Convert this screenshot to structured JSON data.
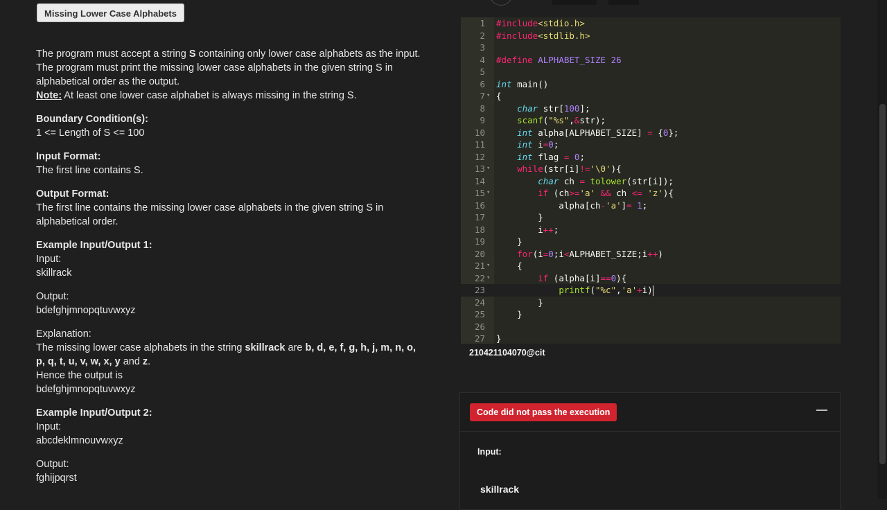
{
  "problem": {
    "title": "Missing Lower Case Alphabets",
    "desc_pre": "The program must accept a string ",
    "desc_var": "S",
    "desc_post": " containing only lower case alphabets as the input. The program must print the missing lower case alphabets in the given string S in alphabetical order as the output.",
    "note_label": "Note:",
    "note_text": " At least one lower case alphabet is always missing in the string S.",
    "boundary_heading": "Boundary Condition(s):",
    "boundary_text": "1 <= Length of S <= 100",
    "input_format_heading": "Input Format:",
    "input_format_text": "The first line contains S.",
    "output_format_heading": "Output Format:",
    "output_format_text": "The first line contains the missing lower case alphabets in the given string S in alphabetical order.",
    "example1_heading": "Example Input/Output 1:",
    "input_label": "Input:",
    "example1_input": "skillrack",
    "output_label": "Output:",
    "example1_output": "bdefghjmnopqtuvwxyz",
    "explanation_label": "Explanation:",
    "expl_pre": "The missing lower case alphabets in the string ",
    "expl_word": "skillrack",
    "expl_mid": " are ",
    "expl_letters": "b, d, e, f, g, h, j, m, n, o, p, q, t, u, v, w, x, y",
    "expl_and": " and ",
    "expl_last": "z",
    "expl_end": ".",
    "hence_text": "Hence the output is",
    "hence_output": "bdefghjmnopqtuvwxyz",
    "example2_heading": "Example Input/Output 2:",
    "example2_input": "abcdeklmnouvwxyz",
    "example2_output": "fghijpqrst"
  },
  "editor": {
    "active_line": 23,
    "lines": [
      {
        "n": 1,
        "fold": false,
        "tokens": [
          [
            "op",
            "#include"
          ],
          [
            "str",
            "<stdio.h>"
          ]
        ]
      },
      {
        "n": 2,
        "fold": false,
        "tokens": [
          [
            "op",
            "#include"
          ],
          [
            "str",
            "<stdlib.h>"
          ]
        ]
      },
      {
        "n": 3,
        "fold": false,
        "tokens": []
      },
      {
        "n": 4,
        "fold": false,
        "tokens": [
          [
            "op",
            "#define"
          ],
          [
            "t",
            " "
          ],
          [
            "con",
            "ALPHABET_SIZE"
          ],
          [
            "t",
            " "
          ],
          [
            "num",
            "26"
          ]
        ]
      },
      {
        "n": 5,
        "fold": false,
        "tokens": []
      },
      {
        "n": 6,
        "fold": false,
        "tokens": [
          [
            "kw",
            "int"
          ],
          [
            "t",
            " main()"
          ]
        ]
      },
      {
        "n": 7,
        "fold": true,
        "tokens": [
          [
            "t",
            "{"
          ]
        ]
      },
      {
        "n": 8,
        "fold": false,
        "tokens": [
          [
            "t",
            "    "
          ],
          [
            "kw",
            "char"
          ],
          [
            "t",
            " str["
          ],
          [
            "num",
            "100"
          ],
          [
            "t",
            "];"
          ]
        ]
      },
      {
        "n": 9,
        "fold": false,
        "tokens": [
          [
            "t",
            "    "
          ],
          [
            "fn",
            "scanf"
          ],
          [
            "t",
            "("
          ],
          [
            "str",
            "\"%s\""
          ],
          [
            "t",
            ","
          ],
          [
            "op",
            "&"
          ],
          [
            "t",
            "str);"
          ]
        ]
      },
      {
        "n": 10,
        "fold": false,
        "tokens": [
          [
            "t",
            "    "
          ],
          [
            "kw",
            "int"
          ],
          [
            "t",
            " alpha[ALPHABET_SIZE] "
          ],
          [
            "op",
            "="
          ],
          [
            "t",
            " {"
          ],
          [
            "num",
            "0"
          ],
          [
            "t",
            "};"
          ]
        ]
      },
      {
        "n": 11,
        "fold": false,
        "tokens": [
          [
            "t",
            "    "
          ],
          [
            "kw",
            "int"
          ],
          [
            "t",
            " i"
          ],
          [
            "op",
            "="
          ],
          [
            "num",
            "0"
          ],
          [
            "t",
            ";"
          ]
        ]
      },
      {
        "n": 12,
        "fold": false,
        "tokens": [
          [
            "t",
            "    "
          ],
          [
            "kw",
            "int"
          ],
          [
            "t",
            " flag "
          ],
          [
            "op",
            "="
          ],
          [
            "t",
            " "
          ],
          [
            "num",
            "0"
          ],
          [
            "t",
            ";"
          ]
        ]
      },
      {
        "n": 13,
        "fold": true,
        "tokens": [
          [
            "t",
            "    "
          ],
          [
            "ctl",
            "while"
          ],
          [
            "t",
            "(str[i]"
          ],
          [
            "op",
            "!="
          ],
          [
            "str",
            "'\\0'"
          ],
          [
            "t",
            "){"
          ]
        ]
      },
      {
        "n": 14,
        "fold": false,
        "tokens": [
          [
            "t",
            "        "
          ],
          [
            "kw",
            "char"
          ],
          [
            "t",
            " ch "
          ],
          [
            "op",
            "="
          ],
          [
            "t",
            " "
          ],
          [
            "fn",
            "tolower"
          ],
          [
            "t",
            "(str[i]);"
          ]
        ]
      },
      {
        "n": 15,
        "fold": true,
        "tokens": [
          [
            "t",
            "        "
          ],
          [
            "ctl",
            "if"
          ],
          [
            "t",
            " (ch"
          ],
          [
            "op",
            ">="
          ],
          [
            "str",
            "'a'"
          ],
          [
            "t",
            " "
          ],
          [
            "op",
            "&&"
          ],
          [
            "t",
            " ch "
          ],
          [
            "op",
            "<="
          ],
          [
            "t",
            " "
          ],
          [
            "str",
            "'z'"
          ],
          [
            "t",
            "){"
          ]
        ]
      },
      {
        "n": 16,
        "fold": false,
        "tokens": [
          [
            "t",
            "            alpha[ch"
          ],
          [
            "op",
            "-"
          ],
          [
            "str",
            "'a'"
          ],
          [
            "t",
            "]"
          ],
          [
            "op",
            "="
          ],
          [
            "t",
            " "
          ],
          [
            "num",
            "1"
          ],
          [
            "t",
            ";"
          ]
        ]
      },
      {
        "n": 17,
        "fold": false,
        "tokens": [
          [
            "t",
            "        }"
          ]
        ]
      },
      {
        "n": 18,
        "fold": false,
        "tokens": [
          [
            "t",
            "        i"
          ],
          [
            "op",
            "++"
          ],
          [
            "t",
            ";"
          ]
        ]
      },
      {
        "n": 19,
        "fold": false,
        "tokens": [
          [
            "t",
            "    }"
          ]
        ]
      },
      {
        "n": 20,
        "fold": false,
        "tokens": [
          [
            "t",
            "    "
          ],
          [
            "ctl",
            "for"
          ],
          [
            "t",
            "(i"
          ],
          [
            "op",
            "="
          ],
          [
            "num",
            "0"
          ],
          [
            "t",
            ";i"
          ],
          [
            "op",
            "<"
          ],
          [
            "t",
            "ALPHABET_SIZE;i"
          ],
          [
            "op",
            "++"
          ],
          [
            "t",
            ")"
          ]
        ]
      },
      {
        "n": 21,
        "fold": true,
        "tokens": [
          [
            "t",
            "    {"
          ]
        ]
      },
      {
        "n": 22,
        "fold": true,
        "tokens": [
          [
            "t",
            "        "
          ],
          [
            "ctl",
            "if"
          ],
          [
            "t",
            " (alpha[i]"
          ],
          [
            "op",
            "=="
          ],
          [
            "num",
            "0"
          ],
          [
            "t",
            "){"
          ]
        ]
      },
      {
        "n": 23,
        "fold": false,
        "tokens": [
          [
            "t",
            "            "
          ],
          [
            "fn",
            "printf"
          ],
          [
            "t",
            "("
          ],
          [
            "str",
            "\"%c\""
          ],
          [
            "t",
            ","
          ],
          [
            "str",
            "'a'"
          ],
          [
            "op",
            "+"
          ],
          [
            "t",
            "i)"
          ],
          [
            "cursor",
            ""
          ]
        ]
      },
      {
        "n": 24,
        "fold": false,
        "tokens": [
          [
            "t",
            "        }"
          ]
        ]
      },
      {
        "n": 25,
        "fold": false,
        "tokens": [
          [
            "t",
            "    }"
          ]
        ]
      },
      {
        "n": 26,
        "fold": false,
        "tokens": []
      },
      {
        "n": 27,
        "fold": false,
        "tokens": [
          [
            "t",
            "}"
          ]
        ]
      }
    ]
  },
  "user_id": "210421104070@cit",
  "result": {
    "status": "Code did not pass the execution",
    "status_color": "#d1242f",
    "input_label": "Input:",
    "input_value": "skillrack"
  }
}
